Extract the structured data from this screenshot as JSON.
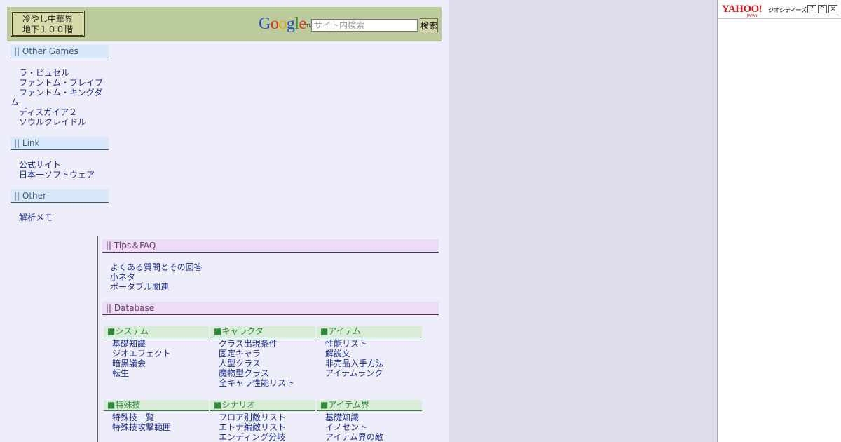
{
  "header": {
    "logo_line1": "冷やし中華界",
    "logo_line2": "地下１００階",
    "google_letters": [
      "G",
      "o",
      "o",
      "g",
      "l",
      "e"
    ],
    "google_tm": "TM",
    "search_placeholder": "サイト内検索",
    "search_button": "検索"
  },
  "sidebar": {
    "other_games": {
      "title": "|| Other Games",
      "items": [
        "ラ・ピュセル",
        "ファントム・ブレイブ",
        "ファントム・キングダム",
        "ディスガイア２",
        "ソウルクレイドル"
      ]
    },
    "link": {
      "title": "|| Link",
      "items": [
        "公式サイト",
        "日本一ソフトウェア"
      ]
    },
    "other": {
      "title": "|| Other",
      "items": [
        "解析メモ"
      ]
    }
  },
  "main": {
    "tips": {
      "title": "|| Tips＆FAQ",
      "items": [
        "よくある質問とその回答",
        "小ネタ",
        "ポータブル関連"
      ]
    },
    "database": {
      "title": "|| Database",
      "sections": [
        {
          "title": "■システム",
          "items": [
            "基礎知識",
            "ジオエフェクト",
            "暗黒議会",
            "転生"
          ]
        },
        {
          "title": "■キャラクタ",
          "items": [
            "クラス出現条件",
            "固定キャラ",
            "人型クラス",
            "魔物型クラス",
            "全キャラ性能リスト"
          ]
        },
        {
          "title": "■アイテム",
          "items": [
            "性能リスト",
            "解説文",
            "非売品入手方法",
            "アイテムランク"
          ]
        },
        {
          "title": "■特殊技",
          "items": [
            "特殊技一覧",
            "特殊技攻撃範囲"
          ]
        },
        {
          "title": "■シナリオ",
          "items": [
            "フロア別敵リスト",
            "エトナ編敵リスト",
            "エンディング分岐"
          ]
        },
        {
          "title": "■アイテム界",
          "items": [
            "基礎知識",
            "イノセント",
            "アイテム界の敵"
          ]
        }
      ]
    }
  },
  "yahoo_panel": {
    "logo": "YAHOO!",
    "logo_sub": "JAPAN",
    "brand": "ジオシティーズ",
    "buttons": [
      "?",
      "^",
      "×"
    ]
  },
  "colors": {
    "page_bg": "#eeeefb",
    "outer_bg": "#dedded",
    "header_bg": "#bccb9b",
    "link": "#1c2f8a",
    "sidebar_head_bg": "#d9e9fb",
    "main_head_bg": "#ecdcf5",
    "db_head_bg": "#d8ecd8"
  }
}
